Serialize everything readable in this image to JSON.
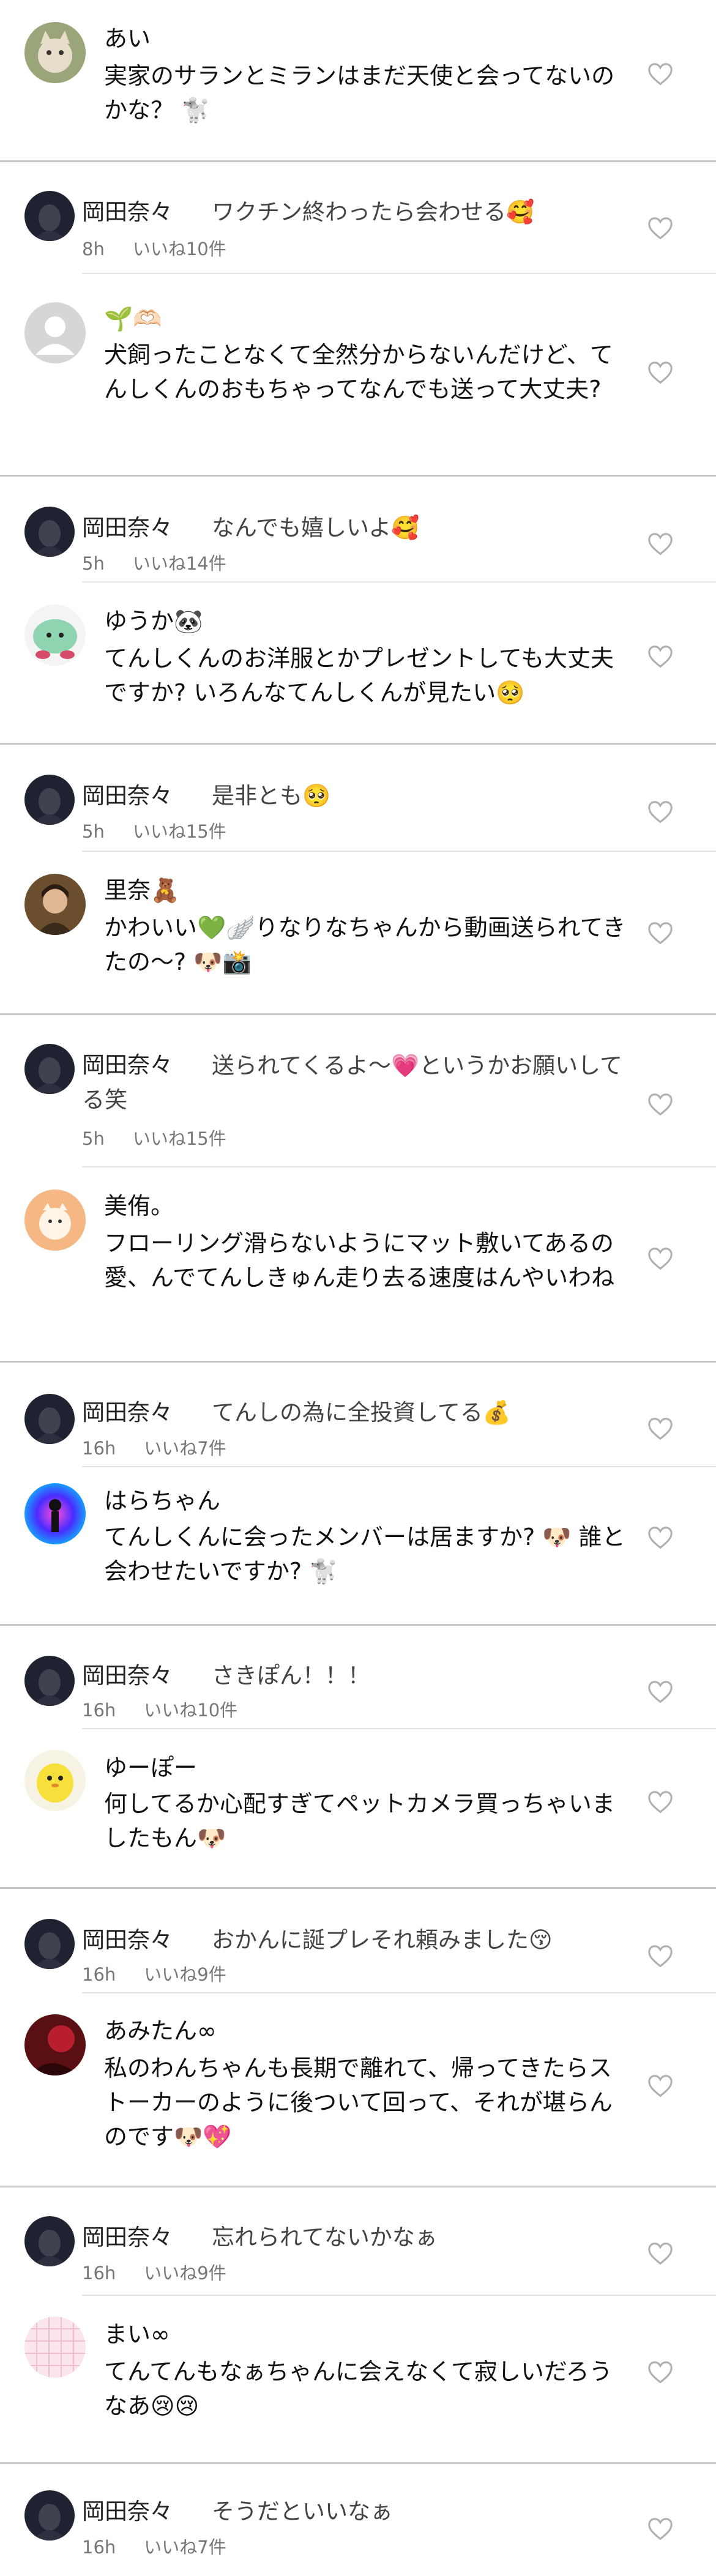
{
  "threads": [
    {
      "question": {
        "name": "あい",
        "text": "実家のサランとミランはまだ天使と会ってないのかな？ 🐩",
        "avatar": "cat-photo"
      },
      "reply": {
        "name": "岡田奈々",
        "text": "ワクチン終わったら会わせる🥰",
        "time": "8h",
        "likes": "いいね10件",
        "avatar": "dark-portrait"
      }
    },
    {
      "question": {
        "name": "🌱🫶🏻",
        "text": "犬飼ったことなくて全然分からないんだけど、てんしくんのおもちゃってなんでも送って大丈夫?",
        "avatar": "default-person"
      },
      "reply": {
        "name": "岡田奈々",
        "text": "なんでも嬉しいよ🥰",
        "time": "5h",
        "likes": "いいね14件",
        "avatar": "dark-portrait"
      }
    },
    {
      "question": {
        "name": "ゆうか🐼",
        "text": "てんしくんのお洋服とかプレゼントしても大丈夫ですか? いろんなてんしくんが見たい🥺",
        "avatar": "green-plush"
      },
      "reply": {
        "name": "岡田奈々",
        "text": "是非とも🥺",
        "time": "5h",
        "likes": "いいね15件",
        "avatar": "dark-portrait"
      }
    },
    {
      "question": {
        "name": "里奈🧸",
        "text": "かわいい💚🪽りなりなちゃんから動画送られてきたの～? 🐶📸",
        "avatar": "girl-photo"
      },
      "reply": {
        "name": "岡田奈々",
        "text": "送られてくるよ～💗というかお願いしてる笑",
        "time": "5h",
        "likes": "いいね15件",
        "avatar": "dark-portrait"
      }
    },
    {
      "question": {
        "name": "美侑。",
        "text": "フローリング滑らないようにマット敷いてあるの愛、んでてんしきゅん走り去る速度はんやいわね",
        "avatar": "cartoon-sticker"
      },
      "reply": {
        "name": "岡田奈々",
        "text": "てんしの為に全投資してる💰",
        "time": "16h",
        "likes": "いいね7件",
        "avatar": "dark-portrait"
      }
    },
    {
      "question": {
        "name": "はらちゃん",
        "text": "てんしくんに会ったメンバーは居ますか? 🐶 誰と会わせたいですか? 🐩",
        "avatar": "neon-figure"
      },
      "reply": {
        "name": "岡田奈々",
        "text": "さきぽん！！！",
        "time": "16h",
        "likes": "いいね10件",
        "avatar": "dark-portrait"
      }
    },
    {
      "question": {
        "name": "ゆーぽー",
        "text": "何してるか心配すぎてペットカメラ買っちゃいましたもん🐶",
        "avatar": "yellow-character"
      },
      "reply": {
        "name": "岡田奈々",
        "text": "おかんに誕プレそれ頼みました😚",
        "time": "16h",
        "likes": "いいね9件",
        "avatar": "dark-portrait"
      }
    },
    {
      "question": {
        "name": "あみたん∞",
        "text": "私のわんちゃんも長期で離れて、帰ってきたらストーカーのように後ついて回って、それが堪らんのです🐶💖",
        "avatar": "red-photo"
      },
      "reply": {
        "name": "岡田奈々",
        "text": "忘れられてないかなぁ",
        "time": "16h",
        "likes": "いいね9件",
        "avatar": "dark-portrait"
      }
    },
    {
      "question": {
        "name": "まい∞",
        "text": "てんてんもなぁちゃんに会えなくて寂しいだろうなあ😢😢",
        "avatar": "pink-grid"
      },
      "reply": {
        "name": "岡田奈々",
        "text": "そうだといいなぁ",
        "time": "16h",
        "likes": "いいね7件",
        "avatar": "dark-portrait"
      }
    }
  ]
}
